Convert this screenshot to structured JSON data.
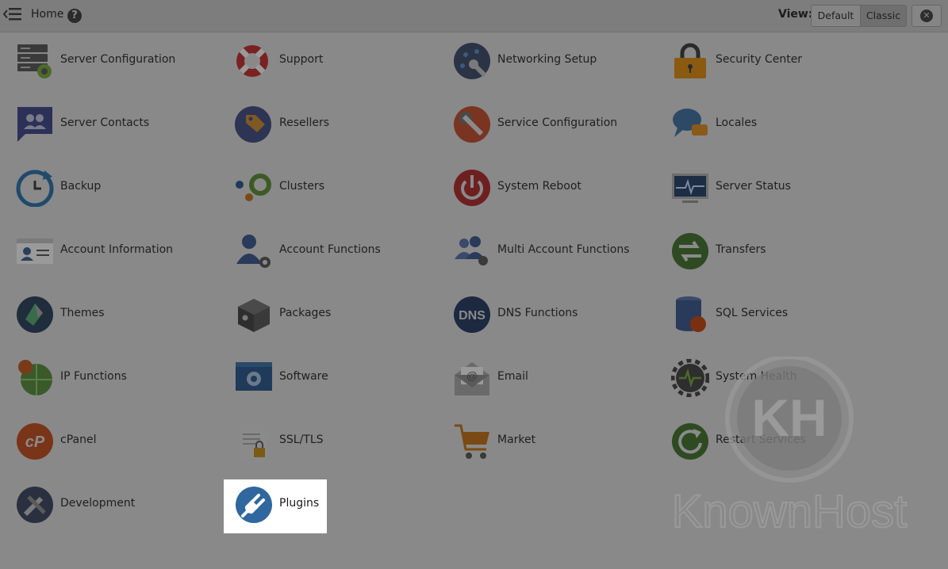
{
  "topbar": {
    "home_label": "Home",
    "view_label": "View:",
    "view_default": "Default",
    "view_classic": "Classic"
  },
  "items": [
    {
      "label": "Server Configuration",
      "icon": "server-gear-icon"
    },
    {
      "label": "Support",
      "icon": "lifebuoy-icon"
    },
    {
      "label": "Networking Setup",
      "icon": "network-wrench-icon"
    },
    {
      "label": "Security Center",
      "icon": "padlock-icon"
    },
    {
      "label": "Server Contacts",
      "icon": "contacts-bubble-icon"
    },
    {
      "label": "Resellers",
      "icon": "price-tag-icon"
    },
    {
      "label": "Service Configuration",
      "icon": "wrench-gear-icon"
    },
    {
      "label": "Locales",
      "icon": "speech-bubbles-icon"
    },
    {
      "label": "Backup",
      "icon": "backup-clock-icon"
    },
    {
      "label": "Clusters",
      "icon": "cluster-circles-icon"
    },
    {
      "label": "System Reboot",
      "icon": "power-icon"
    },
    {
      "label": "Server Status",
      "icon": "monitor-pulse-icon"
    },
    {
      "label": "Account Information",
      "icon": "id-card-icon"
    },
    {
      "label": "Account Functions",
      "icon": "user-gear-icon"
    },
    {
      "label": "Multi Account Functions",
      "icon": "users-gear-icon"
    },
    {
      "label": "Transfers",
      "icon": "transfer-arrows-icon"
    },
    {
      "label": "Themes",
      "icon": "paint-drop-icon"
    },
    {
      "label": "Packages",
      "icon": "package-box-icon"
    },
    {
      "label": "DNS Functions",
      "icon": "dns-icon"
    },
    {
      "label": "SQL Services",
      "icon": "database-icon"
    },
    {
      "label": "IP Functions",
      "icon": "ip-globe-icon"
    },
    {
      "label": "Software",
      "icon": "software-window-icon"
    },
    {
      "label": "Email",
      "icon": "envelope-at-icon"
    },
    {
      "label": "System Health",
      "icon": "gear-pulse-icon"
    },
    {
      "label": "cPanel",
      "icon": "cpanel-logo-icon"
    },
    {
      "label": "SSL/TLS",
      "icon": "certificate-lock-icon"
    },
    {
      "label": "Market",
      "icon": "shopping-cart-icon"
    },
    {
      "label": "Restart Services",
      "icon": "restart-arrow-icon"
    },
    {
      "label": "Development",
      "icon": "development-tools-icon"
    },
    {
      "label": "Plugins",
      "icon": "plug-icon"
    }
  ],
  "watermark": {
    "text": "KnownHost",
    "mark": "KH"
  }
}
